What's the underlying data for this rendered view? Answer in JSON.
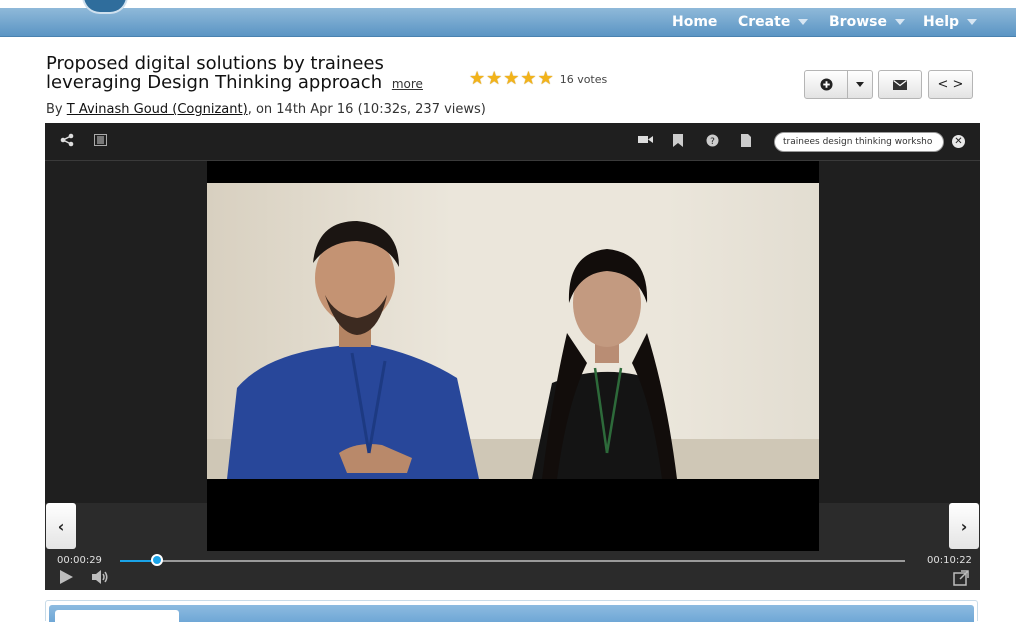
{
  "nav": {
    "items": [
      "Home",
      "Create",
      "Browse",
      "Help"
    ]
  },
  "video": {
    "title": "Proposed digital solutions by trainees leveraging Design Thinking approach",
    "more_label": "more",
    "rating_stars": 5,
    "votes_label": "16 votes",
    "by_prefix": "By",
    "author": "T Avinash Goud (Cognizant)",
    "meta": ", on 14th Apr 16 (10:32s, 237 views)"
  },
  "actions": {
    "add_icon": "plus-circle-icon",
    "dropdown_icon": "caret-down-icon",
    "email_icon": "envelope-icon",
    "embed_label": "< >"
  },
  "player": {
    "search_value": "trainees design thinking worksho",
    "current_time": "00:00:29",
    "total_time": "00:10:22",
    "progress": 0.0466,
    "accent": "#1aa3e8"
  }
}
